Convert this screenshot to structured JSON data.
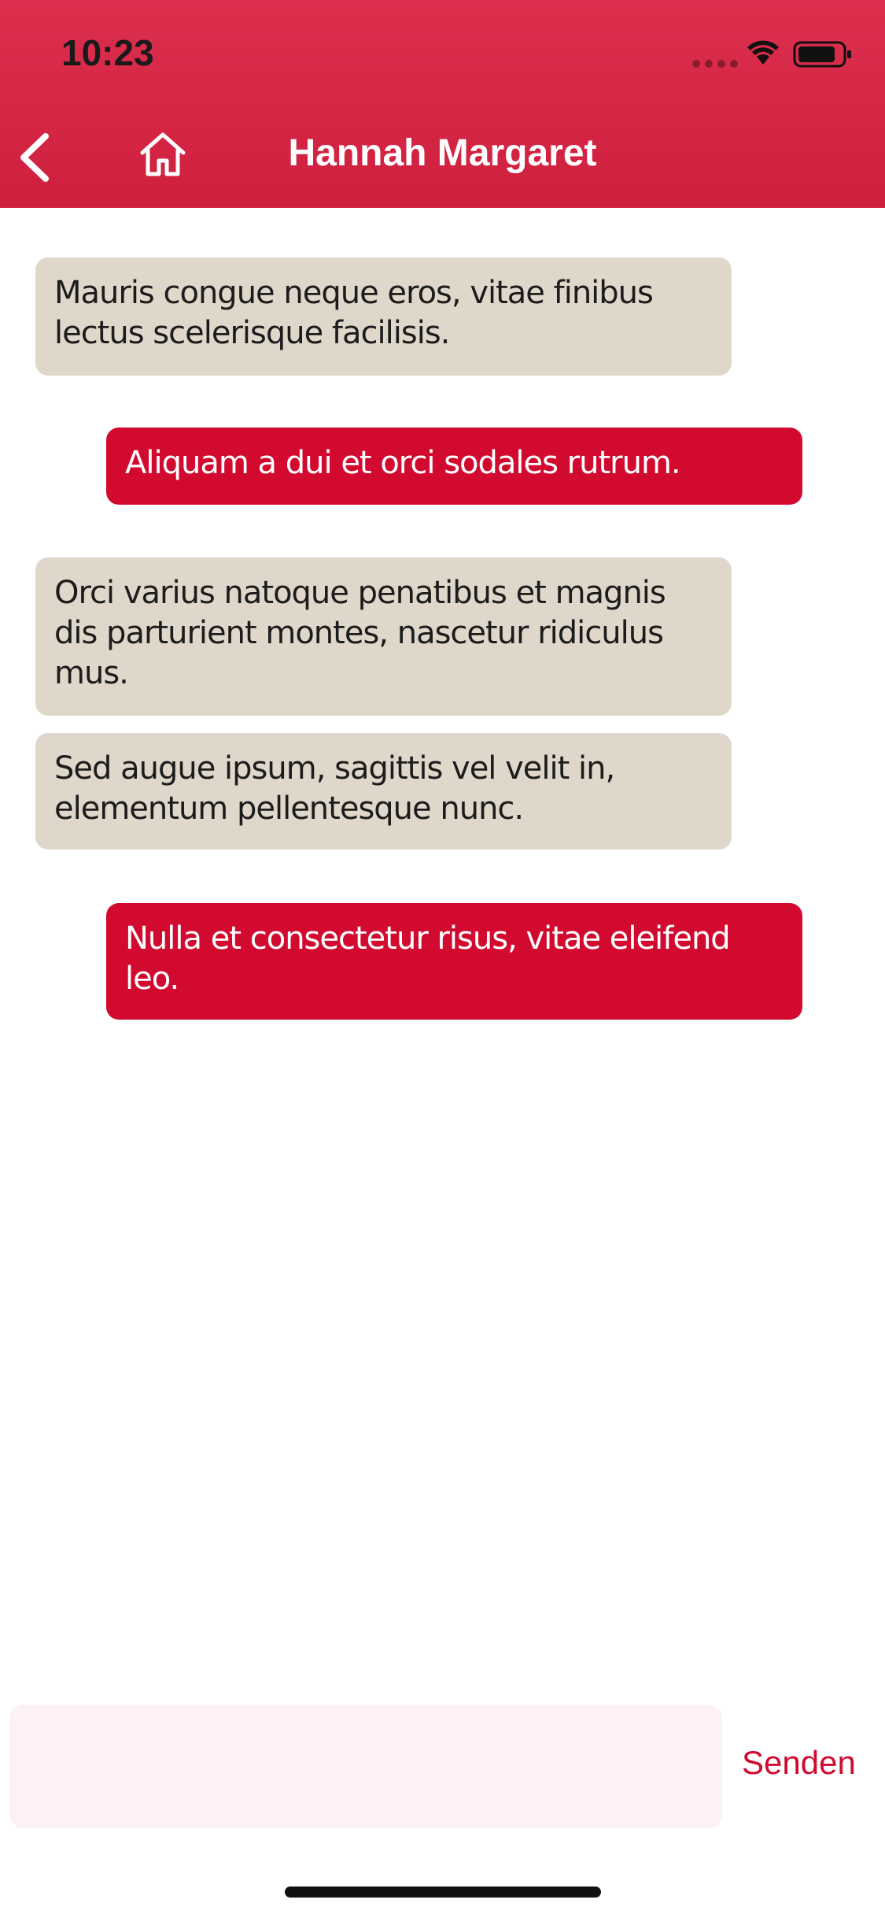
{
  "status_bar": {
    "time": "10:23"
  },
  "header": {
    "title": "Hannah Margaret",
    "back_icon": "chevron-left-icon",
    "home_icon": "home-icon",
    "bar_color": "#d52643"
  },
  "messages": [
    {
      "direction": "incoming",
      "text": "Mauris congue neque eros, vitae finibus lectus scelerisque facilisis."
    },
    {
      "direction": "outgoing",
      "text": "Aliquam a dui et orci sodales rutrum."
    },
    {
      "direction": "incoming",
      "text": "Orci varius natoque penatibus et magnis dis parturient montes, nascetur ridiculus mus."
    },
    {
      "direction": "incoming",
      "text": "Sed augue ipsum, sagittis vel velit in, elementum pellentesque nunc."
    },
    {
      "direction": "outgoing",
      "text": "Nulla et consectetur risus, vitae eleifend leo."
    }
  ],
  "composer": {
    "input_value": "",
    "placeholder": "",
    "send_label": "Senden"
  },
  "colors": {
    "incoming_bubble": "#e0d7cb",
    "outgoing_bubble": "#d20a2f",
    "accent": "#d20a2f"
  }
}
